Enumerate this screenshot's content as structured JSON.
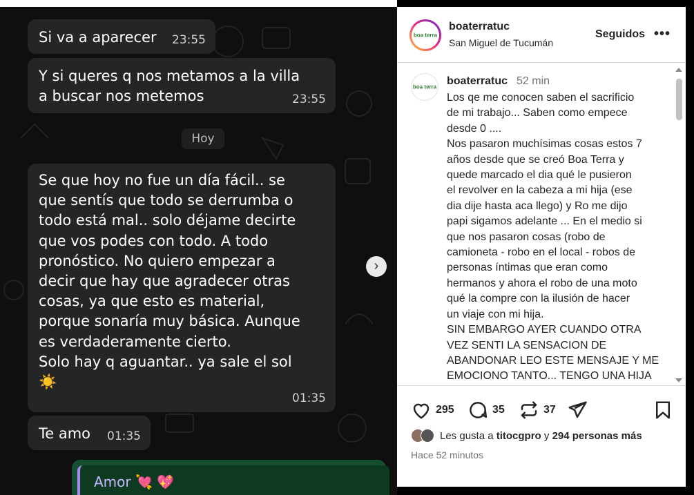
{
  "chat": {
    "messages": [
      {
        "text": "Si va a aparecer",
        "time": "23:55"
      },
      {
        "text": "Y si queres q nos metamos a la villa\na buscar nos metemos",
        "time": "23:55"
      },
      {
        "text": "Se que hoy no fue un día fácil.. se\nque sentís que todo se derrumba o\ntodo está mal.. solo déjame decirte\nque vos podes con todo. A todo\npronóstico. No quiero empezar a\ndecir que hay que agradecer otras\ncosas, ya que esto es material,\nporque sonaría muy básica. Aunque\nes verdaderamente cierto.\nSolo hay q aguantar.. ya sale el sol\n☀️",
        "time": "01:35"
      },
      {
        "text": "Te amo",
        "time": "01:35"
      }
    ],
    "date_separator": "Hoy",
    "reply_preview": "Amor 💘 💖",
    "nav_icon": "chevron-right-icon"
  },
  "instagram": {
    "header": {
      "username": "boaterratuc",
      "location": "San Miguel de Tucumán",
      "follow_label": "Seguidos",
      "more_label": "•••",
      "logo_text": "boa terra"
    },
    "caption": {
      "username": "boaterratuc",
      "time": "52 min",
      "text": "Los qe me conocen saben el sacrificio\nde mi trabajo... Saben como empece\ndesde 0 ....\nNos pasaron muchísimas cosas estos 7\naños desde que se creó Boa Terra y\nquede marcado el dia qué le pusieron\nel revolver en la cabeza a mi hija (ese\ndia dije hasta aca llego) y Ro me dijo\npapi sigamos adelante ... En el medio si\nque nos pasaron cosas (robo de\ncamioneta - robo en el local - robos de\npersonas íntimas que eran como\nhermanos y ahora el robo de una moto\nqué la compre con la ilusión de hacer\nun viaje con mi hija.\nSIN EMBARGO AYER CUANDO OTRA\nVEZ SENTI LA SENSACION DE\nABANDONAR LEO ESTE MENSAJE Y ME\nEMOCIONO TANTO... TENGO UNA HIJA"
    },
    "actions": {
      "likes_count": "295",
      "comments_count": "35",
      "reposts_count": "37"
    },
    "likes_line": {
      "prefix": "Les gusta a",
      "user": "titocgpro",
      "connector": "y",
      "others": "294 personas más"
    },
    "ago": "Hace 52 minutos"
  }
}
